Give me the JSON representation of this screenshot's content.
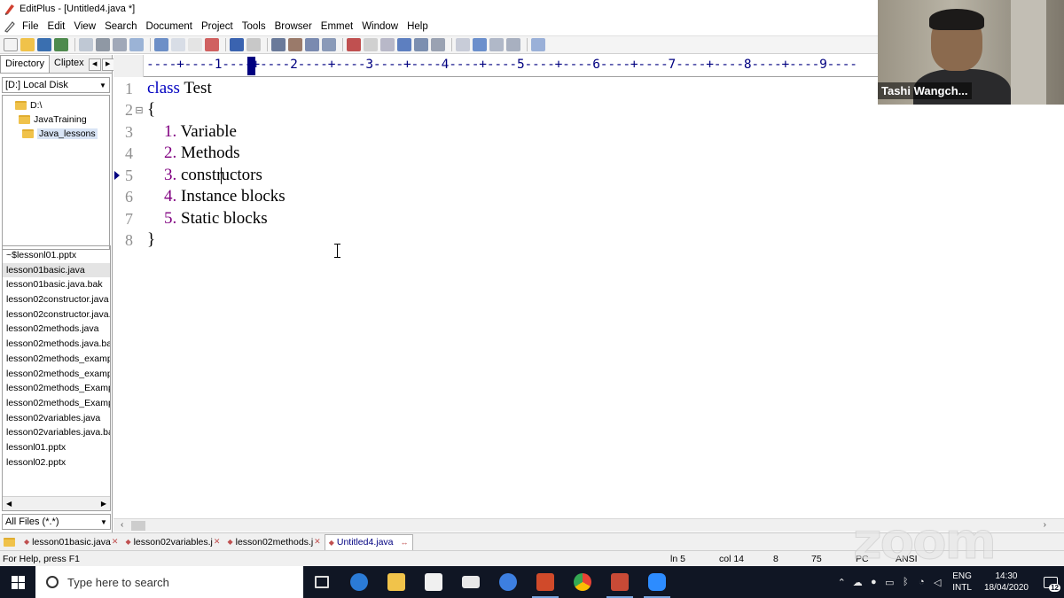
{
  "window": {
    "title": "EditPlus - [Untitled4.java *]"
  },
  "menu": [
    "File",
    "Edit",
    "View",
    "Search",
    "Document",
    "Project",
    "Tools",
    "Browser",
    "Emmet",
    "Window",
    "Help"
  ],
  "left_panel": {
    "tabs": [
      "Directory",
      "Cliptex"
    ],
    "drive": "[D:] Local Disk",
    "tree": [
      "D:\\",
      "JavaTraining",
      "Java_lessons"
    ],
    "files": [
      "~$lessonl01.pptx",
      "lesson01basic.java",
      "lesson01basic.java.bak",
      "lesson02constructor.java",
      "lesson02constructor.java.",
      "lesson02methods.java",
      "lesson02methods.java.ba",
      "lesson02methods_examp",
      "lesson02methods_examp",
      "lesson02methods_Examp",
      "lesson02methods_Examp",
      "lesson02variables.java",
      "lesson02variables.java.ba",
      "lessonl01.pptx",
      "lessonl02.pptx"
    ],
    "filter": "All Files (*.*)"
  },
  "ruler": "----+----1----+----2----+----3----+----4----+----5----+----6----+----7----+----8----+----9----",
  "editor": {
    "lines": [
      {
        "n": "1",
        "kw": "class",
        "text": " Test"
      },
      {
        "n": "2",
        "kw": "",
        "text": "{"
      },
      {
        "n": "3",
        "num": "1.",
        "text": " Variable"
      },
      {
        "n": "4",
        "num": "2.",
        "text": " Methods"
      },
      {
        "n": "5",
        "num": "3.",
        "pre": " constr",
        "post": "uctors"
      },
      {
        "n": "6",
        "num": "4.",
        "text": " Instance blocks"
      },
      {
        "n": "7",
        "num": "5.",
        "text": " Static blocks"
      },
      {
        "n": "8",
        "kw": "",
        "text": "}"
      }
    ]
  },
  "doc_tabs": [
    "lesson01basic.java",
    "lesson02variables.j",
    "lesson02methods.j",
    "Untitled4.java"
  ],
  "status": {
    "help": "For Help, press F1",
    "line": "ln 5",
    "col": "col 14",
    "a": "8",
    "b": "75",
    "pc": "PC",
    "enc": "ANSI"
  },
  "taskbar": {
    "search_placeholder": "Type here to search",
    "lang1": "ENG",
    "lang2": "INTL",
    "time": "14:30",
    "date": "18/04/2020",
    "notif": "12"
  },
  "zoom": {
    "participant": "Tashi Wangch...",
    "watermark": "zoom"
  },
  "colors": {
    "keyword": "#0000c0",
    "number": "#800080",
    "ruler": "#000080",
    "taskbar": "#101624"
  }
}
